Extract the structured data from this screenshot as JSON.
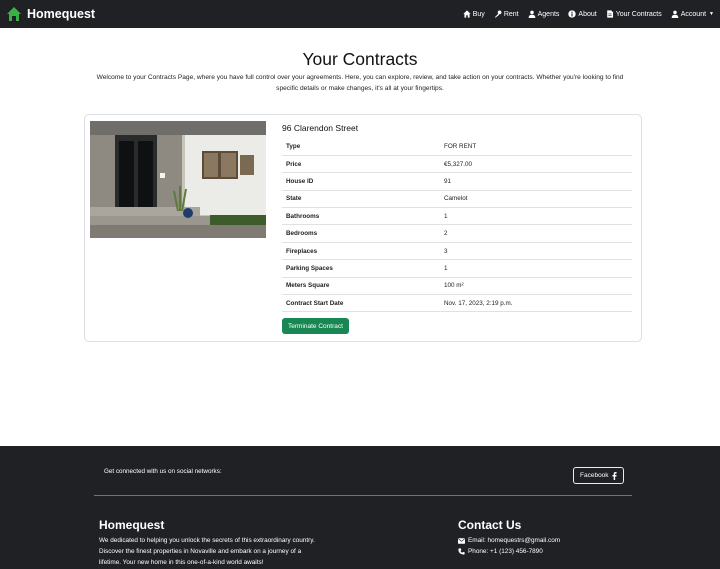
{
  "colors": {
    "navbar_bg": "#1f2124",
    "brand_icon": "#3cb043",
    "accent_green": "#198754",
    "footer_bg": "#1f2124"
  },
  "navbar": {
    "brand": "Homequest",
    "links": [
      {
        "label": "Buy",
        "icon": "home-icon"
      },
      {
        "label": "Rent",
        "icon": "key-icon"
      },
      {
        "label": "Agents",
        "icon": "users-icon"
      },
      {
        "label": "About",
        "icon": "info-icon"
      },
      {
        "label": "Your Contracts",
        "icon": "document-icon"
      },
      {
        "label": "Account",
        "icon": "user-icon"
      }
    ]
  },
  "header": {
    "title": "Your Contracts",
    "intro": "Welcome to your Contracts Page, where you have full control over your agreements. Here, you can explore, review, and take action on your contracts. Whether you're looking to find specific details or make changes, it's all at your fingertips."
  },
  "contract": {
    "address": "96 Clarendon Street",
    "details": [
      {
        "label": "Type",
        "value": "FOR RENT"
      },
      {
        "label": "Price",
        "value": "€5,327.00"
      },
      {
        "label": "House ID",
        "value": "91"
      },
      {
        "label": "State",
        "value": "Camelot"
      },
      {
        "label": "Bathrooms",
        "value": "1"
      },
      {
        "label": "Bedrooms",
        "value": "2"
      },
      {
        "label": "Fireplaces",
        "value": "3"
      },
      {
        "label": "Parking Spaces",
        "value": "1"
      },
      {
        "label": "Meters Square",
        "value": "100 m²"
      },
      {
        "label": "Contract Start Date",
        "value": "Nov. 17, 2023, 2:19 p.m."
      }
    ],
    "terminate_label": "Terminate Contract"
  },
  "footer": {
    "social_text": "Get connected with us on social networks:",
    "facebook_label": "Facebook",
    "about_title": "Homequest",
    "about_text": "We dedicated to helping you unlock the secrets of this extraordinary country. Discover the finest properties in Novaville and embark on a journey of a lifetime. Your new home in this one-of-a-kind world awaits!",
    "contact_title": "Contact Us",
    "email": "Email: homequestrs@gmail.com",
    "phone": "Phone: +1 (123) 456-7890"
  }
}
